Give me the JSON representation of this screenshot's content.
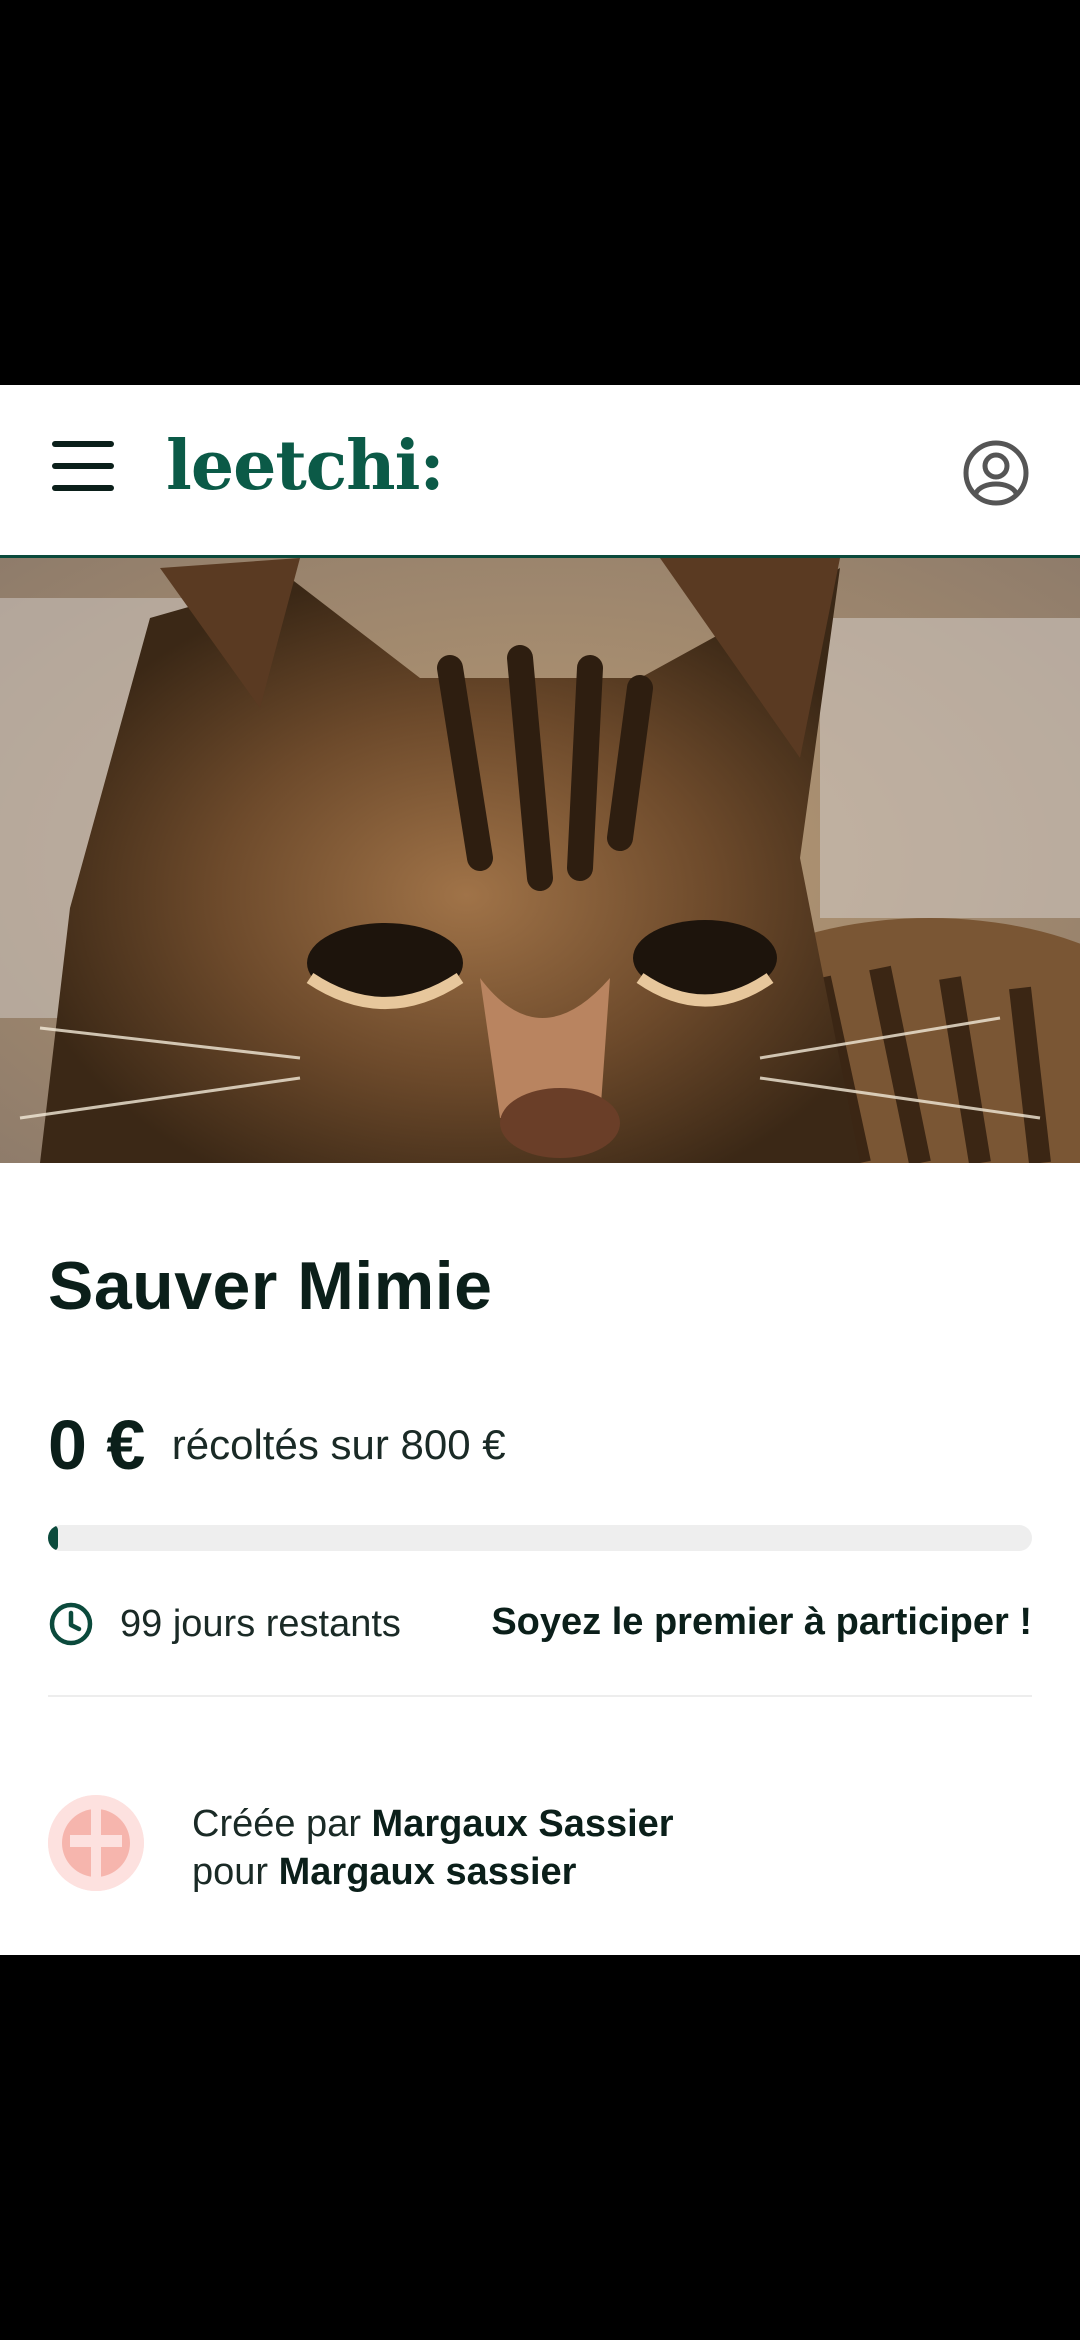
{
  "header": {
    "logo": "leetchi:",
    "menu_icon": "hamburger-menu-icon",
    "account_icon": "user-circle-icon"
  },
  "hero": {
    "image_subject": "tabby cat"
  },
  "campaign": {
    "title": "Sauver Mimie",
    "amount": "0 €",
    "amount_suffix": "récoltés sur 800 €",
    "progress_fraction": 0.0,
    "days_left": "99 jours restants",
    "cta": "Soyez le premier à participer !"
  },
  "creator": {
    "created_by_prefix": "Créée par",
    "created_by_name": "Margaux Sassier",
    "for_prefix": "pour",
    "for_name": "Margaux sassier"
  },
  "colors": {
    "brand": "#0b5a47",
    "progress": "#0b4a3c",
    "text": "#0b1f1a"
  }
}
